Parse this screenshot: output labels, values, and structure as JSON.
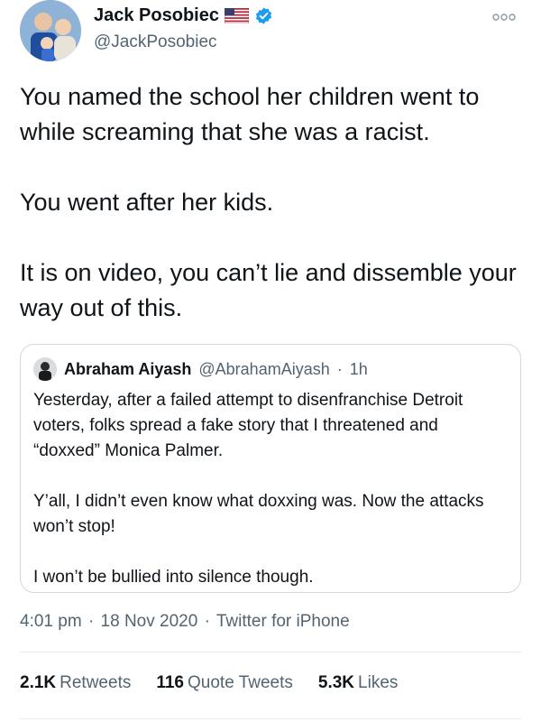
{
  "author": {
    "name": "Jack Posobiec",
    "handle": "@JackPosobiec",
    "flag_icon": "us-flag-icon",
    "verified_icon": "verified-badge-icon",
    "verified_color": "#1d9bf0"
  },
  "more_icon": "more-options-icon",
  "tweet_text": [
    "You named the school her children went to while screaming that she was a racist.",
    "You went after her kids.",
    "It is on video, you can’t lie and dissemble your way out of this."
  ],
  "quoted_tweet": {
    "name": "Abraham Aiyash",
    "handle": "@AbrahamAiyash",
    "time": "1h",
    "separator": "·",
    "paragraphs": [
      "Yesterday, after a failed attempt to disenfranchise Detroit voters, folks spread a fake story that I threatened  and “doxxed” Monica Palmer.",
      "Y’all, I didn’t even know what doxxing was. Now the attacks won’t stop!",
      "I won’t be bullied into silence though."
    ]
  },
  "timestamp": {
    "time": "4:01 pm",
    "date": "18 Nov 2020",
    "source": "Twitter for iPhone",
    "separator": "·"
  },
  "stats": {
    "retweets_count": "2.1K",
    "retweets_label": "Retweets",
    "quotes_count": "116",
    "quotes_label": "Quote Tweets",
    "likes_count": "5.3K",
    "likes_label": "Likes"
  },
  "colors": {
    "text": "#0f1419",
    "secondary": "#536471",
    "border": "#cfd9de"
  }
}
